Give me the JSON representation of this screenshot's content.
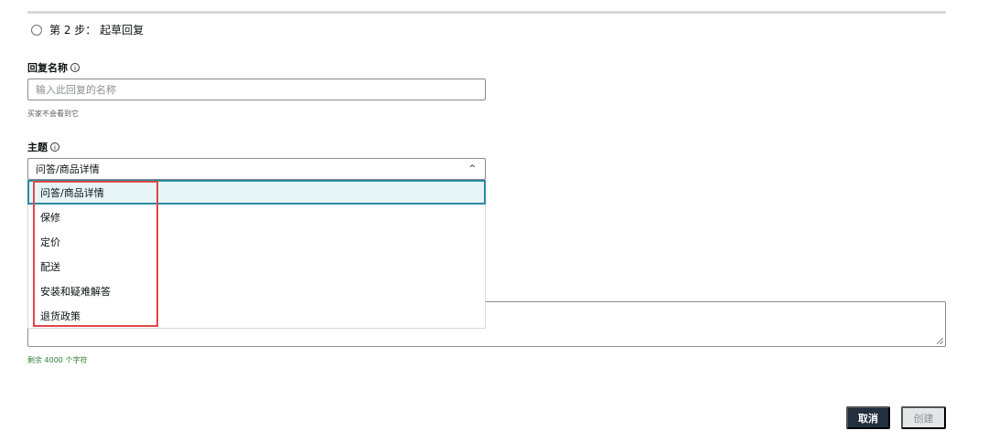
{
  "step": {
    "label": "第 2 步：  起草回复"
  },
  "reply_name": {
    "label": "回复名称",
    "placeholder": "输入此回复的名称",
    "hint": "买家不会看到它"
  },
  "subject": {
    "label": "主题",
    "selected_value": "问答/商品详情",
    "options": [
      "问答/商品详情",
      "保修",
      "定价",
      "配送",
      "安装和疑难解答",
      "退货政策"
    ]
  },
  "message": {
    "remaining_text": "剩余 4000 个字符"
  },
  "actions": {
    "cancel_label": "取消",
    "create_label": "创建"
  },
  "icons": {
    "info": "info-icon",
    "chevron": "chevron-up-icon",
    "step": "radio-circle-icon"
  },
  "colors": {
    "accent": "#2a8aa0",
    "highlight_outline": "#e0474c",
    "primary_button": "#232f3e",
    "disabled_button": "#e3e6e6",
    "remaining_text": "#2f7d32"
  }
}
